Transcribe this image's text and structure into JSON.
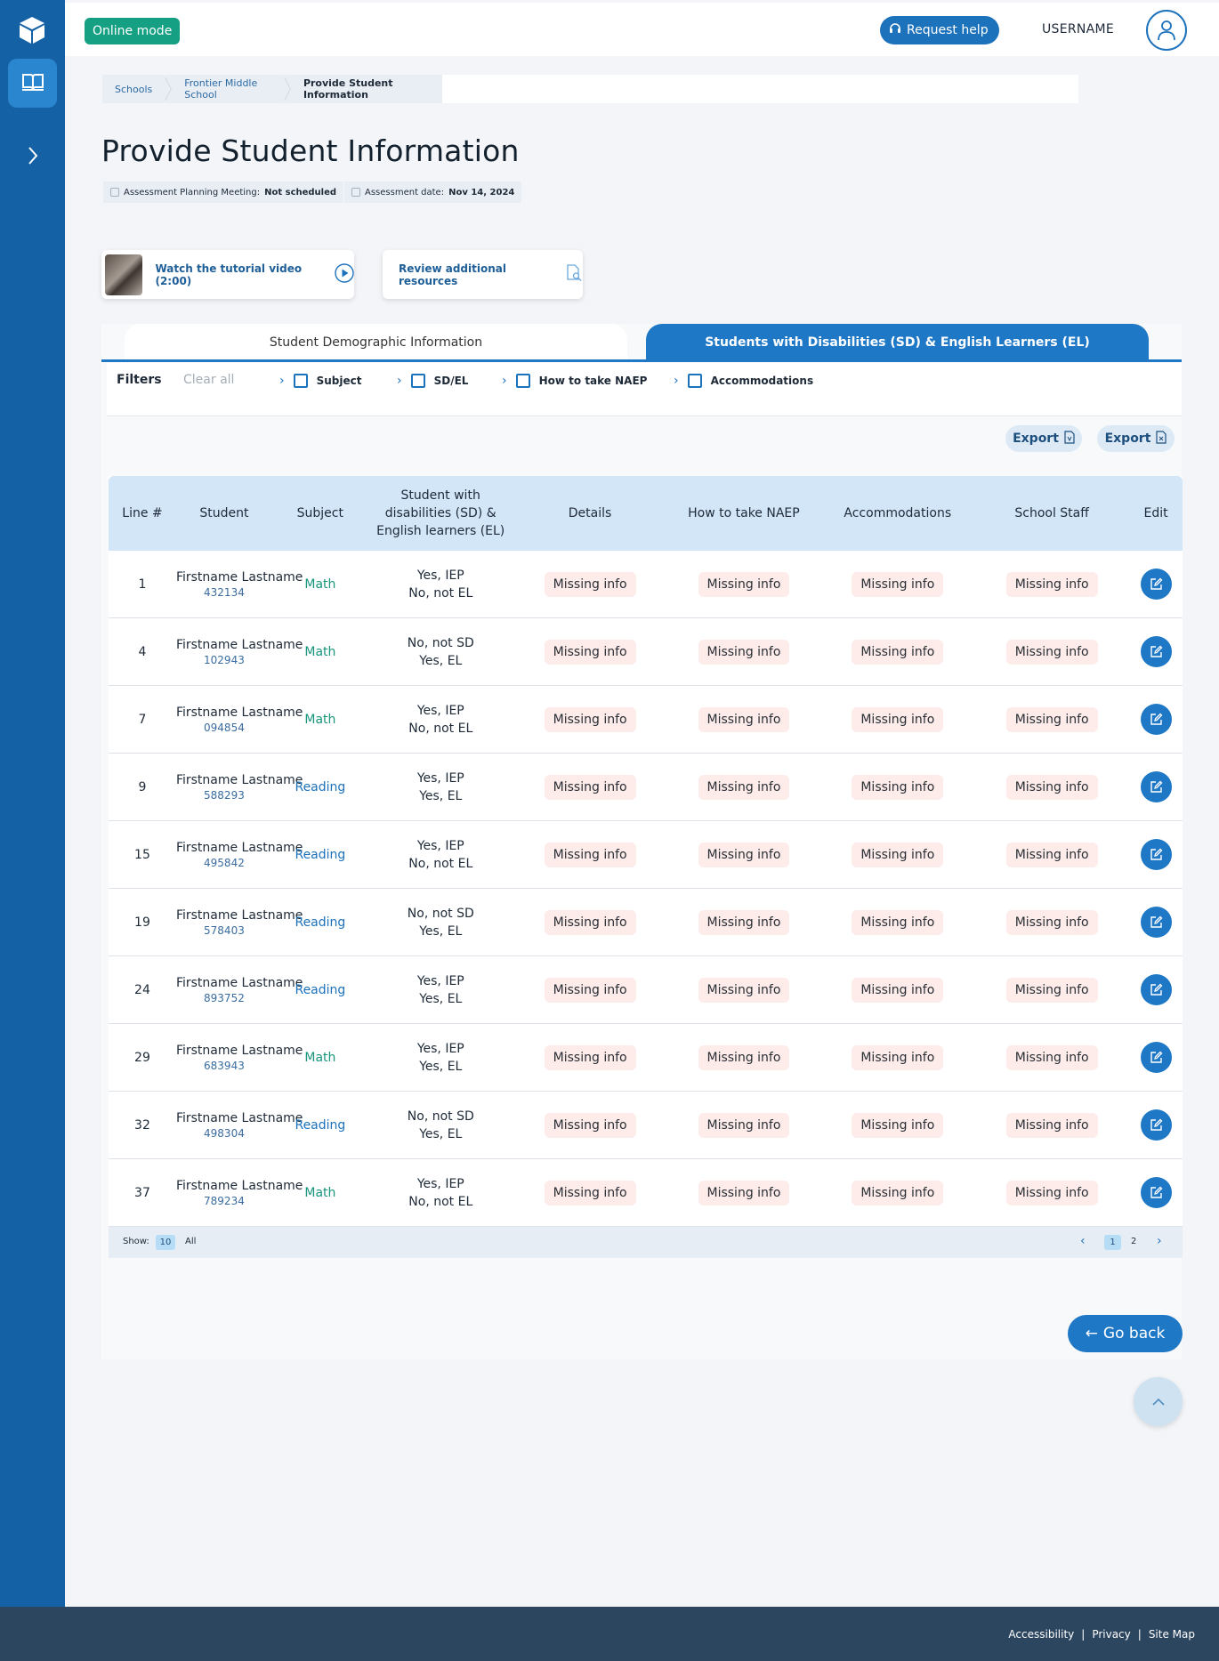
{
  "topbar": {
    "mode": "Online mode",
    "help": "Request help",
    "username": "USERNAME"
  },
  "breadcrumb": [
    "Schools",
    "Frontier Middle School",
    "Provide Student Information"
  ],
  "page": {
    "title": "Provide Student Information",
    "meeting_label": "Assessment Planning Meeting:",
    "meeting_value": "Not scheduled",
    "date_label": "Assessment date:",
    "date_value": "Nov 14, 2024"
  },
  "resources": {
    "tutorial": "Watch the tutorial video (2:00)",
    "review": "Review additional resources"
  },
  "tabs": {
    "demographic": "Student Demographic Information",
    "sd_el": "Students with Disabilities (SD) & English Learners (EL)"
  },
  "filters": {
    "label": "Filters",
    "clear": "Clear all",
    "items": [
      "Subject",
      "SD/EL",
      "How to take NAEP",
      "Accommodations"
    ]
  },
  "export": {
    "pdf": "Export",
    "xls": "Export"
  },
  "table": {
    "headers": [
      "Line #",
      "Student",
      "Subject",
      "Student with disabilities (SD) & English learners (EL)",
      "Details",
      "How to take NAEP",
      "Accommodations",
      "School Staff",
      "Edit"
    ],
    "rows": [
      {
        "line": "1",
        "name": "Firstname Lastname",
        "id": "432134",
        "subject": "Math",
        "sd": "Yes, IEP",
        "el": "No, not EL",
        "details": "Missing info",
        "how": "Missing info",
        "acc": "Missing info",
        "staff": "Missing info"
      },
      {
        "line": "4",
        "name": "Firstname Lastname",
        "id": "102943",
        "subject": "Math",
        "sd": "No, not SD",
        "el": "Yes, EL",
        "details": "Missing info",
        "how": "Missing info",
        "acc": "Missing info",
        "staff": "Missing info"
      },
      {
        "line": "7",
        "name": "Firstname Lastname",
        "id": "094854",
        "subject": "Math",
        "sd": "Yes, IEP",
        "el": "No, not EL",
        "details": "Missing info",
        "how": "Missing info",
        "acc": "Missing info",
        "staff": "Missing info"
      },
      {
        "line": "9",
        "name": "Firstname Lastname",
        "id": "588293",
        "subject": "Reading",
        "sd": "Yes, IEP",
        "el": "Yes, EL",
        "details": "Missing info",
        "how": "Missing info",
        "acc": "Missing info",
        "staff": "Missing info"
      },
      {
        "line": "15",
        "name": "Firstname Lastname",
        "id": "495842",
        "subject": "Reading",
        "sd": "Yes, IEP",
        "el": "No, not EL",
        "details": "Missing info",
        "how": "Missing info",
        "acc": "Missing info",
        "staff": "Missing info"
      },
      {
        "line": "19",
        "name": "Firstname Lastname",
        "id": "578403",
        "subject": "Reading",
        "sd": "No, not SD",
        "el": "Yes, EL",
        "details": "Missing info",
        "how": "Missing info",
        "acc": "Missing info",
        "staff": "Missing info"
      },
      {
        "line": "24",
        "name": "Firstname Lastname",
        "id": "893752",
        "subject": "Reading",
        "sd": "Yes, IEP",
        "el": "Yes, EL",
        "details": "Missing info",
        "how": "Missing info",
        "acc": "Missing info",
        "staff": "Missing info"
      },
      {
        "line": "29",
        "name": "Firstname Lastname",
        "id": "683943",
        "subject": "Math",
        "sd": "Yes, IEP",
        "el": "Yes, EL",
        "details": "Missing info",
        "how": "Missing info",
        "acc": "Missing info",
        "staff": "Missing info"
      },
      {
        "line": "32",
        "name": "Firstname Lastname",
        "id": "498304",
        "subject": "Reading",
        "sd": "No, not SD",
        "el": "Yes, EL",
        "details": "Missing info",
        "how": "Missing info",
        "acc": "Missing info",
        "staff": "Missing info"
      },
      {
        "line": "37",
        "name": "Firstname Lastname",
        "id": "789234",
        "subject": "Math",
        "sd": "Yes, IEP",
        "el": "No, not EL",
        "details": "Missing info",
        "how": "Missing info",
        "acc": "Missing info",
        "staff": "Missing info"
      }
    ]
  },
  "pagination": {
    "show_label": "Show:",
    "show_10": "10",
    "show_all": "All",
    "page_1": "1",
    "page_2": "2"
  },
  "actions": {
    "go_back": "Go back"
  },
  "footer": {
    "links": [
      "Accessibility",
      "Privacy",
      "Site Map"
    ]
  },
  "colors": {
    "sidebar": "#1561a6",
    "primary": "#1f78c6",
    "online": "#16a083",
    "math": "#16957b",
    "missing_bg": "#fdecea",
    "footer": "#2d4660"
  },
  "icons": {
    "logo": "cube-icon",
    "nav": "book-icon",
    "expand": "chevron-right-icon",
    "help": "headset-icon",
    "user": "user-icon",
    "play": "play-icon",
    "resources": "document-search-icon",
    "edit": "edit-icon",
    "scroll": "chevron-up-icon"
  }
}
